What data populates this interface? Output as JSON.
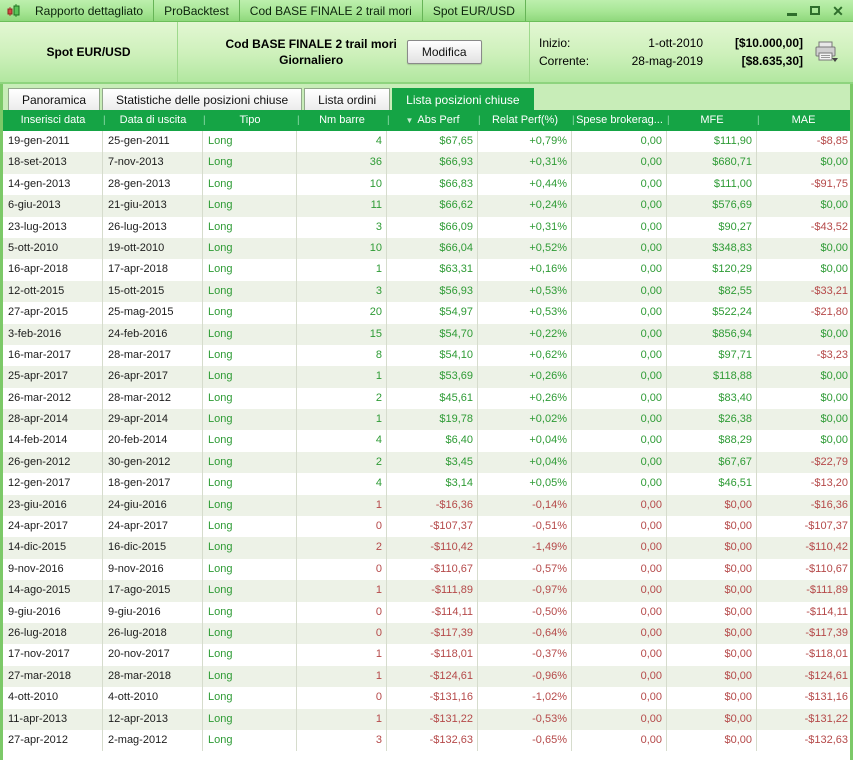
{
  "window": {
    "titlebar_tabs": [
      {
        "label": "Rapporto dettagliato"
      },
      {
        "label": "ProBacktest"
      },
      {
        "label": "Cod BASE FINALE 2 trail mori"
      },
      {
        "label": "Spot EUR/USD"
      }
    ],
    "controls": [
      {
        "name": "minimize"
      },
      {
        "name": "maximize"
      },
      {
        "name": "close"
      }
    ]
  },
  "header": {
    "instrument": "Spot EUR/USD",
    "system_name": "Cod BASE FINALE 2 trail mori",
    "timeframe": "Giornaliero",
    "modify_button": "Modifica",
    "inizio_label": "Inizio:",
    "inizio_date": "1-ott-2010",
    "inizio_value": "[$10.000,00]",
    "corrente_label": "Corrente:",
    "corrente_date": "28-mag-2019",
    "corrente_value": "[$8.635,30]"
  },
  "tabs": [
    {
      "label": "Panoramica",
      "active": false
    },
    {
      "label": "Statistiche delle posizioni chiuse",
      "active": false
    },
    {
      "label": "Lista ordini",
      "active": false
    },
    {
      "label": "Lista posizioni chiuse",
      "active": true
    }
  ],
  "table": {
    "columns": [
      {
        "label": "Inserisci data",
        "align": "left"
      },
      {
        "label": "Data di uscita",
        "align": "left"
      },
      {
        "label": "Tipo",
        "align": "left"
      },
      {
        "label": "Nm barre",
        "align": "right"
      },
      {
        "label": "Abs Perf",
        "align": "right",
        "sort": "desc"
      },
      {
        "label": "Relat Perf(%)",
        "align": "right"
      },
      {
        "label": "Spese brokerag...",
        "align": "right"
      },
      {
        "label": "MFE",
        "align": "right"
      },
      {
        "label": "MAE",
        "align": "right"
      }
    ],
    "rows": [
      {
        "entry": "19-gen-2011",
        "exit": "25-gen-2011",
        "tipo": "Long",
        "barre": "4",
        "abs": "$67,65",
        "relat": "+0,79%",
        "spese": "0,00",
        "mfe": "$111,90",
        "mae": "-$8,85",
        "result": "win"
      },
      {
        "entry": "18-set-2013",
        "exit": "7-nov-2013",
        "tipo": "Long",
        "barre": "36",
        "abs": "$66,93",
        "relat": "+0,31%",
        "spese": "0,00",
        "mfe": "$680,71",
        "mae": "$0,00",
        "result": "win"
      },
      {
        "entry": "14-gen-2013",
        "exit": "28-gen-2013",
        "tipo": "Long",
        "barre": "10",
        "abs": "$66,83",
        "relat": "+0,44%",
        "spese": "0,00",
        "mfe": "$111,00",
        "mae": "-$91,75",
        "result": "win"
      },
      {
        "entry": "6-giu-2013",
        "exit": "21-giu-2013",
        "tipo": "Long",
        "barre": "11",
        "abs": "$66,62",
        "relat": "+0,24%",
        "spese": "0,00",
        "mfe": "$576,69",
        "mae": "$0,00",
        "result": "win"
      },
      {
        "entry": "23-lug-2013",
        "exit": "26-lug-2013",
        "tipo": "Long",
        "barre": "3",
        "abs": "$66,09",
        "relat": "+0,31%",
        "spese": "0,00",
        "mfe": "$90,27",
        "mae": "-$43,52",
        "result": "win"
      },
      {
        "entry": "5-ott-2010",
        "exit": "19-ott-2010",
        "tipo": "Long",
        "barre": "10",
        "abs": "$66,04",
        "relat": "+0,52%",
        "spese": "0,00",
        "mfe": "$348,83",
        "mae": "$0,00",
        "result": "win"
      },
      {
        "entry": "16-apr-2018",
        "exit": "17-apr-2018",
        "tipo": "Long",
        "barre": "1",
        "abs": "$63,31",
        "relat": "+0,16%",
        "spese": "0,00",
        "mfe": "$120,29",
        "mae": "$0,00",
        "result": "win"
      },
      {
        "entry": "12-ott-2015",
        "exit": "15-ott-2015",
        "tipo": "Long",
        "barre": "3",
        "abs": "$56,93",
        "relat": "+0,53%",
        "spese": "0,00",
        "mfe": "$82,55",
        "mae": "-$33,21",
        "result": "win"
      },
      {
        "entry": "27-apr-2015",
        "exit": "25-mag-2015",
        "tipo": "Long",
        "barre": "20",
        "abs": "$54,97",
        "relat": "+0,53%",
        "spese": "0,00",
        "mfe": "$522,24",
        "mae": "-$21,80",
        "result": "win"
      },
      {
        "entry": "3-feb-2016",
        "exit": "24-feb-2016",
        "tipo": "Long",
        "barre": "15",
        "abs": "$54,70",
        "relat": "+0,22%",
        "spese": "0,00",
        "mfe": "$856,94",
        "mae": "$0,00",
        "result": "win"
      },
      {
        "entry": "16-mar-2017",
        "exit": "28-mar-2017",
        "tipo": "Long",
        "barre": "8",
        "abs": "$54,10",
        "relat": "+0,62%",
        "spese": "0,00",
        "mfe": "$97,71",
        "mae": "-$3,23",
        "result": "win"
      },
      {
        "entry": "25-apr-2017",
        "exit": "26-apr-2017",
        "tipo": "Long",
        "barre": "1",
        "abs": "$53,69",
        "relat": "+0,26%",
        "spese": "0,00",
        "mfe": "$118,88",
        "mae": "$0,00",
        "result": "win"
      },
      {
        "entry": "26-mar-2012",
        "exit": "28-mar-2012",
        "tipo": "Long",
        "barre": "2",
        "abs": "$45,61",
        "relat": "+0,26%",
        "spese": "0,00",
        "mfe": "$83,40",
        "mae": "$0,00",
        "result": "win"
      },
      {
        "entry": "28-apr-2014",
        "exit": "29-apr-2014",
        "tipo": "Long",
        "barre": "1",
        "abs": "$19,78",
        "relat": "+0,02%",
        "spese": "0,00",
        "mfe": "$26,38",
        "mae": "$0,00",
        "result": "win"
      },
      {
        "entry": "14-feb-2014",
        "exit": "20-feb-2014",
        "tipo": "Long",
        "barre": "4",
        "abs": "$6,40",
        "relat": "+0,04%",
        "spese": "0,00",
        "mfe": "$88,29",
        "mae": "$0,00",
        "result": "win"
      },
      {
        "entry": "26-gen-2012",
        "exit": "30-gen-2012",
        "tipo": "Long",
        "barre": "2",
        "abs": "$3,45",
        "relat": "+0,04%",
        "spese": "0,00",
        "mfe": "$67,67",
        "mae": "-$22,79",
        "result": "win"
      },
      {
        "entry": "12-gen-2017",
        "exit": "18-gen-2017",
        "tipo": "Long",
        "barre": "4",
        "abs": "$3,14",
        "relat": "+0,05%",
        "spese": "0,00",
        "mfe": "$46,51",
        "mae": "-$13,20",
        "result": "win"
      },
      {
        "entry": "23-giu-2016",
        "exit": "24-giu-2016",
        "tipo": "Long",
        "barre": "1",
        "abs": "-$16,36",
        "relat": "-0,14%",
        "spese": "0,00",
        "mfe": "$0,00",
        "mae": "-$16,36",
        "result": "loss"
      },
      {
        "entry": "24-apr-2017",
        "exit": "24-apr-2017",
        "tipo": "Long",
        "barre": "0",
        "abs": "-$107,37",
        "relat": "-0,51%",
        "spese": "0,00",
        "mfe": "$0,00",
        "mae": "-$107,37",
        "result": "loss"
      },
      {
        "entry": "14-dic-2015",
        "exit": "16-dic-2015",
        "tipo": "Long",
        "barre": "2",
        "abs": "-$110,42",
        "relat": "-1,49%",
        "spese": "0,00",
        "mfe": "$0,00",
        "mae": "-$110,42",
        "result": "loss"
      },
      {
        "entry": "9-nov-2016",
        "exit": "9-nov-2016",
        "tipo": "Long",
        "barre": "0",
        "abs": "-$110,67",
        "relat": "-0,57%",
        "spese": "0,00",
        "mfe": "$0,00",
        "mae": "-$110,67",
        "result": "loss"
      },
      {
        "entry": "14-ago-2015",
        "exit": "17-ago-2015",
        "tipo": "Long",
        "barre": "1",
        "abs": "-$111,89",
        "relat": "-0,97%",
        "spese": "0,00",
        "mfe": "$0,00",
        "mae": "-$111,89",
        "result": "loss"
      },
      {
        "entry": "9-giu-2016",
        "exit": "9-giu-2016",
        "tipo": "Long",
        "barre": "0",
        "abs": "-$114,11",
        "relat": "-0,50%",
        "spese": "0,00",
        "mfe": "$0,00",
        "mae": "-$114,11",
        "result": "loss"
      },
      {
        "entry": "26-lug-2018",
        "exit": "26-lug-2018",
        "tipo": "Long",
        "barre": "0",
        "abs": "-$117,39",
        "relat": "-0,64%",
        "spese": "0,00",
        "mfe": "$0,00",
        "mae": "-$117,39",
        "result": "loss"
      },
      {
        "entry": "17-nov-2017",
        "exit": "20-nov-2017",
        "tipo": "Long",
        "barre": "1",
        "abs": "-$118,01",
        "relat": "-0,37%",
        "spese": "0,00",
        "mfe": "$0,00",
        "mae": "-$118,01",
        "result": "loss"
      },
      {
        "entry": "27-mar-2018",
        "exit": "28-mar-2018",
        "tipo": "Long",
        "barre": "1",
        "abs": "-$124,61",
        "relat": "-0,96%",
        "spese": "0,00",
        "mfe": "$0,00",
        "mae": "-$124,61",
        "result": "loss"
      },
      {
        "entry": "4-ott-2010",
        "exit": "4-ott-2010",
        "tipo": "Long",
        "barre": "0",
        "abs": "-$131,16",
        "relat": "-1,02%",
        "spese": "0,00",
        "mfe": "$0,00",
        "mae": "-$131,16",
        "result": "loss"
      },
      {
        "entry": "11-apr-2013",
        "exit": "12-apr-2013",
        "tipo": "Long",
        "barre": "1",
        "abs": "-$131,22",
        "relat": "-0,53%",
        "spese": "0,00",
        "mfe": "$0,00",
        "mae": "-$131,22",
        "result": "loss"
      },
      {
        "entry": "27-apr-2012",
        "exit": "2-mag-2012",
        "tipo": "Long",
        "barre": "3",
        "abs": "-$132,63",
        "relat": "-0,65%",
        "spese": "0,00",
        "mfe": "$0,00",
        "mae": "-$132,63",
        "result": "loss"
      }
    ]
  },
  "colors": {
    "accent_green": "#15a445",
    "win_text": "#2e9b35",
    "loss_text": "#b54949",
    "frame_green": "#7cc968",
    "titlebar_green": "#a7e695"
  }
}
